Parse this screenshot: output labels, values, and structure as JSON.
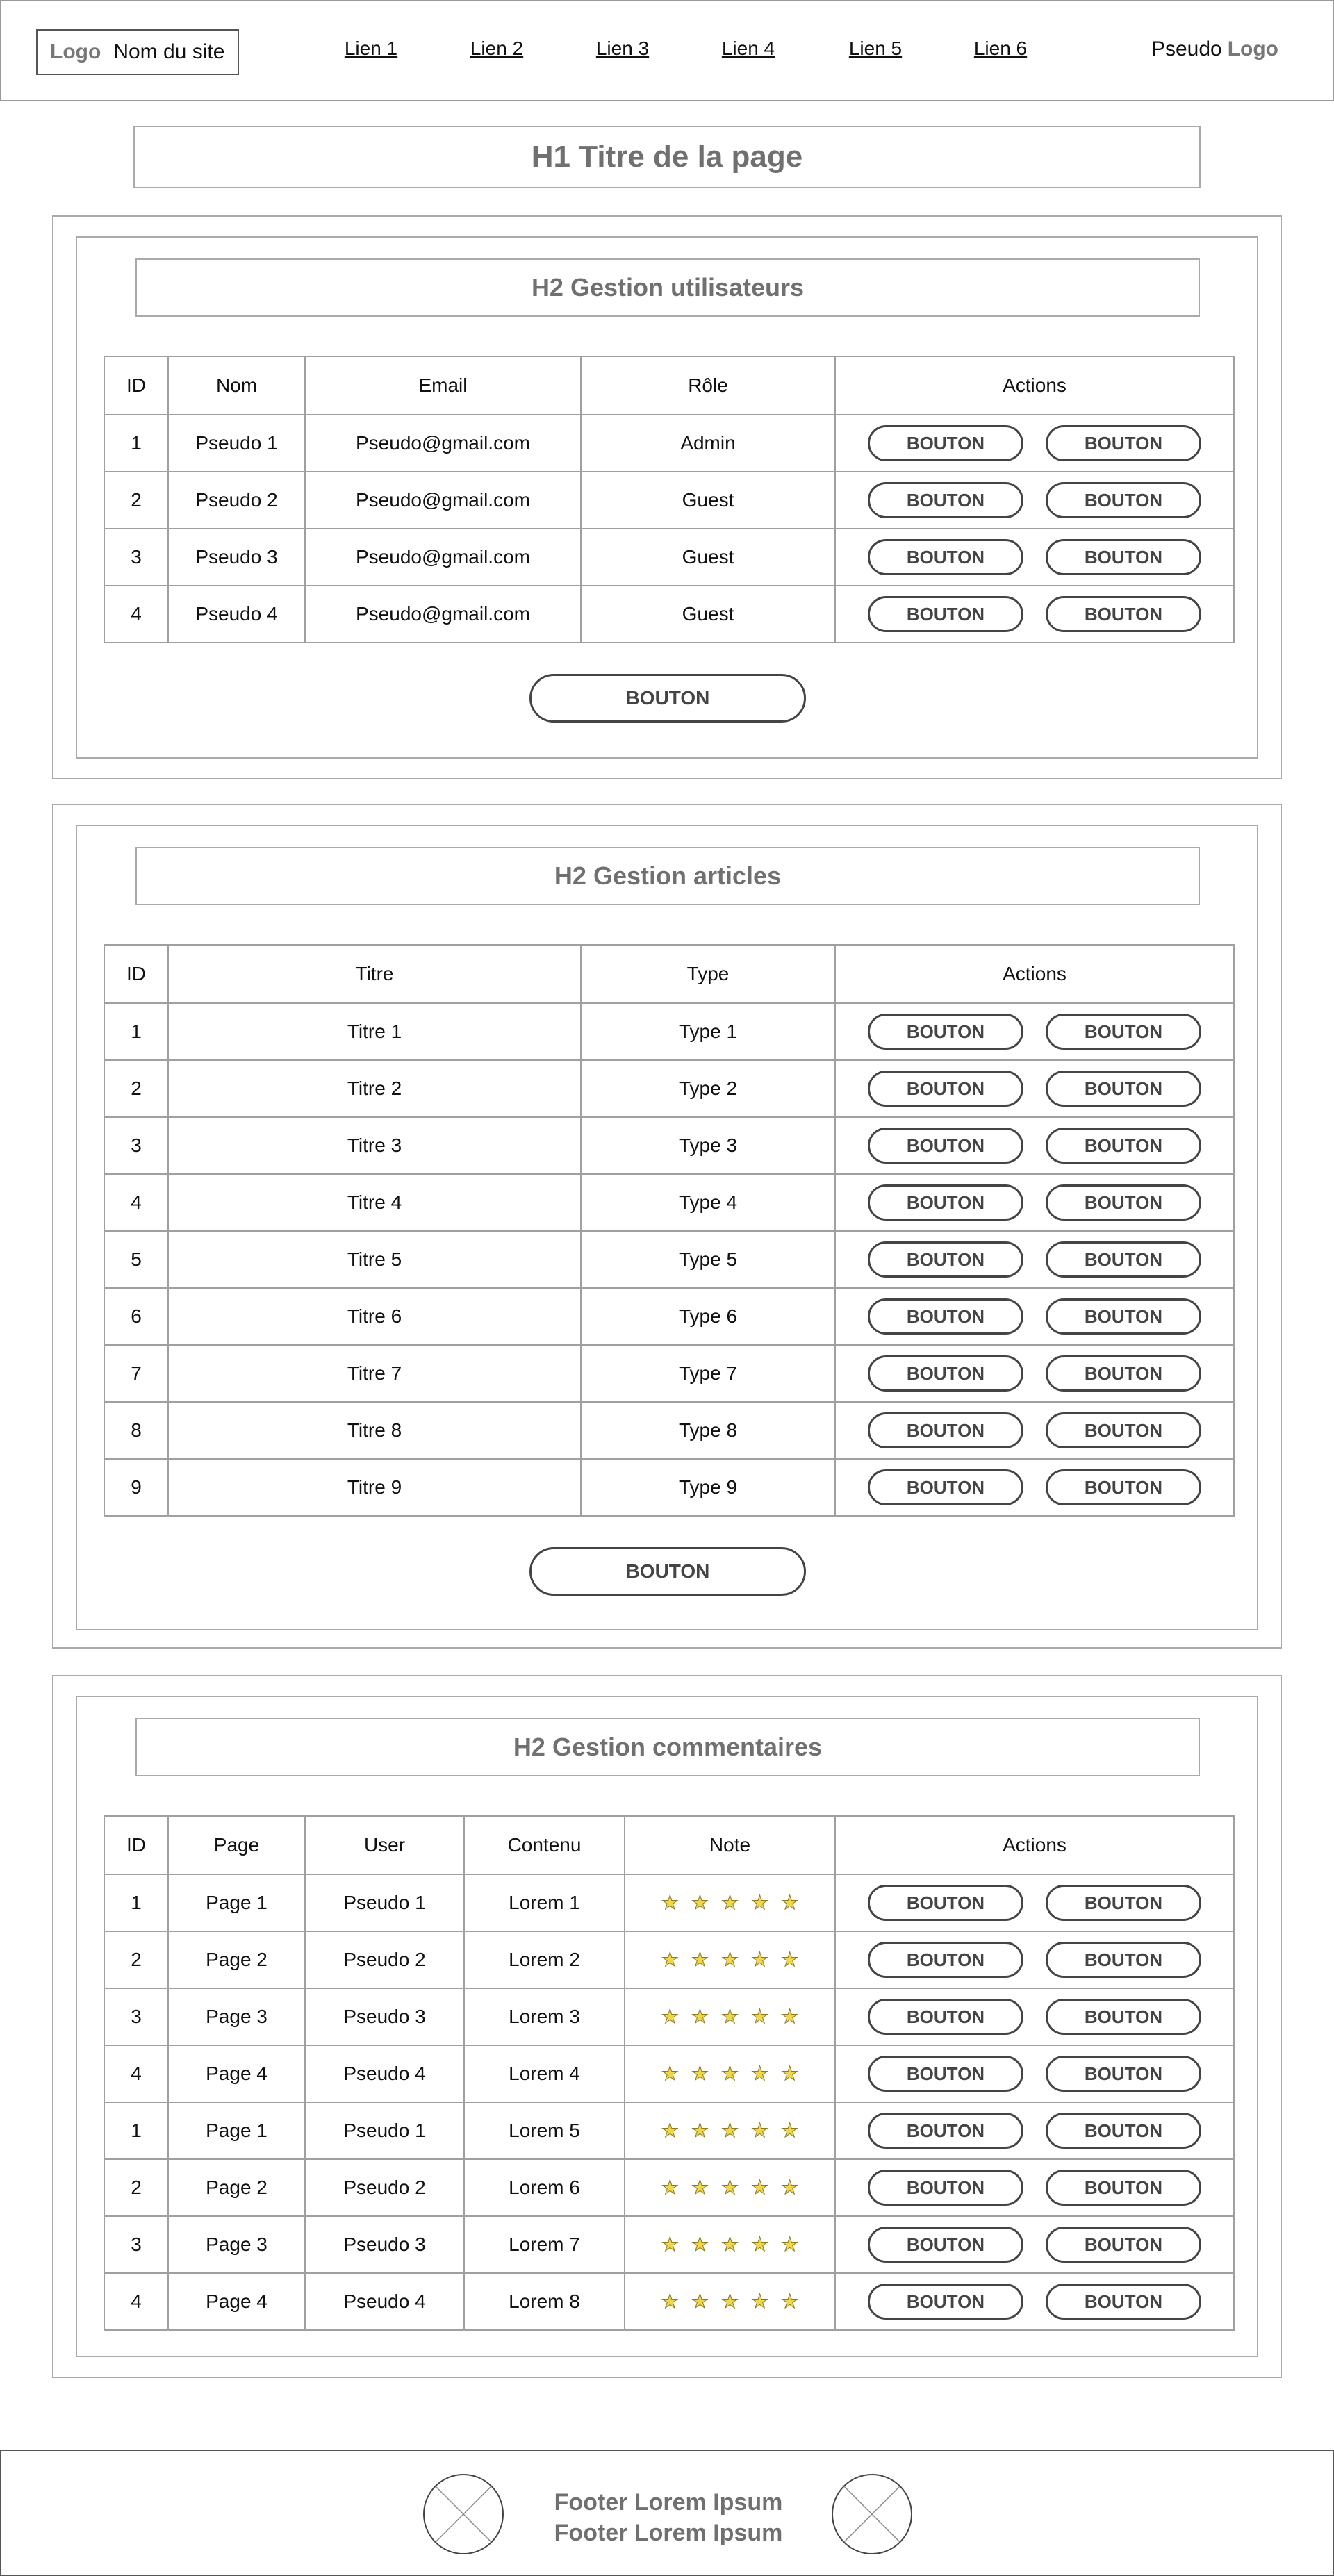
{
  "header": {
    "logo": "Logo",
    "site_name": "Nom du site",
    "nav": [
      "Lien 1",
      "Lien 2",
      "Lien 3",
      "Lien 4",
      "Lien 5",
      "Lien 6"
    ],
    "user_pseudo": "Pseudo",
    "user_logo": "Logo"
  },
  "page_title": "H1 Titre de la page",
  "users": {
    "title": "H2 Gestion utilisateurs",
    "columns": [
      "ID",
      "Nom",
      "Email",
      "Rôle",
      "Actions"
    ],
    "rows": [
      [
        "1",
        "Pseudo 1",
        "Pseudo@gmail.com",
        "Admin"
      ],
      [
        "2",
        "Pseudo 2",
        "Pseudo@gmail.com",
        "Guest"
      ],
      [
        "3",
        "Pseudo 3",
        "Pseudo@gmail.com",
        "Guest"
      ],
      [
        "4",
        "Pseudo 4",
        "Pseudo@gmail.com",
        "Guest"
      ]
    ],
    "button_label": "BOUTON"
  },
  "articles": {
    "title": "H2 Gestion articles",
    "columns": [
      "ID",
      "Titre",
      "Type",
      "Actions"
    ],
    "rows": [
      [
        "1",
        "Titre 1",
        "Type 1"
      ],
      [
        "2",
        "Titre 2",
        "Type 2"
      ],
      [
        "3",
        "Titre 3",
        "Type 3"
      ],
      [
        "4",
        "Titre 4",
        "Type 4"
      ],
      [
        "5",
        "Titre 5",
        "Type 5"
      ],
      [
        "6",
        "Titre 6",
        "Type 6"
      ],
      [
        "7",
        "Titre 7",
        "Type 7"
      ],
      [
        "8",
        "Titre 8",
        "Type 8"
      ],
      [
        "9",
        "Titre 9",
        "Type 9"
      ]
    ],
    "button_label": "BOUTON"
  },
  "comments": {
    "title": "H2 Gestion commentaires",
    "columns": [
      "ID",
      "Page",
      "User",
      "Contenu",
      "Note",
      "Actions"
    ],
    "rows": [
      [
        "1",
        "Page 1",
        "Pseudo 1",
        "Lorem 1"
      ],
      [
        "2",
        "Page 2",
        "Pseudo 2",
        "Lorem 2"
      ],
      [
        "3",
        "Page 3",
        "Pseudo 3",
        "Lorem 3"
      ],
      [
        "4",
        "Page 4",
        "Pseudo 4",
        "Lorem 4"
      ],
      [
        "1",
        "Page 1",
        "Pseudo 1",
        "Lorem 5"
      ],
      [
        "2",
        "Page 2",
        "Pseudo 2",
        "Lorem 6"
      ],
      [
        "3",
        "Page 3",
        "Pseudo 3",
        "Lorem 7"
      ],
      [
        "4",
        "Page 4",
        "Pseudo 4",
        "Lorem 8"
      ]
    ],
    "rating_stars": 5,
    "star_color": "#f2d64a"
  },
  "action_button_label": "BOUTON",
  "footer": {
    "line1": "Footer Lorem Ipsum",
    "line2": "Footer Lorem Ipsum"
  }
}
